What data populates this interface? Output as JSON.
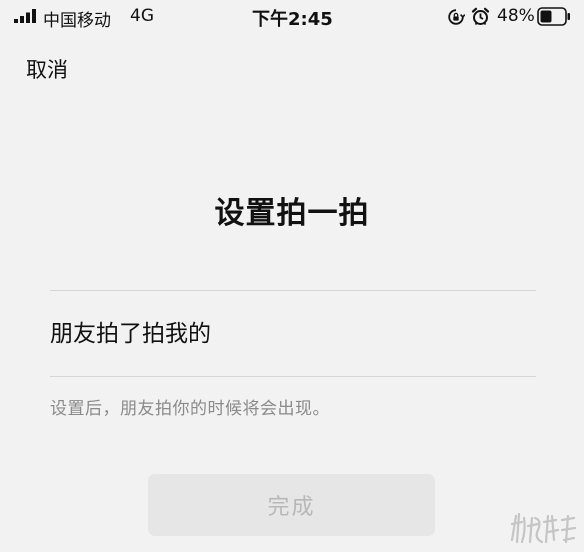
{
  "status_bar": {
    "carrier": "中国移动",
    "network": "4G",
    "time": "下午2:45",
    "battery_percent": "48%",
    "battery_level": 0.48,
    "icons": [
      "signal-icon",
      "rotation-lock-icon",
      "alarm-icon",
      "battery-icon"
    ]
  },
  "nav": {
    "cancel_label": "取消"
  },
  "main": {
    "title": "设置拍一拍",
    "input_value": "朋友拍了拍我的",
    "hint": "设置后，朋友拍你的时候将会出现。",
    "done_label": "完成"
  },
  "colors": {
    "background": "#f2f2f2",
    "text": "#111111",
    "hint": "#8a8a8a",
    "button_bg_disabled": "#e6e6e6",
    "button_text_disabled": "#b8b8b8",
    "divider": "#d6d6d6"
  }
}
